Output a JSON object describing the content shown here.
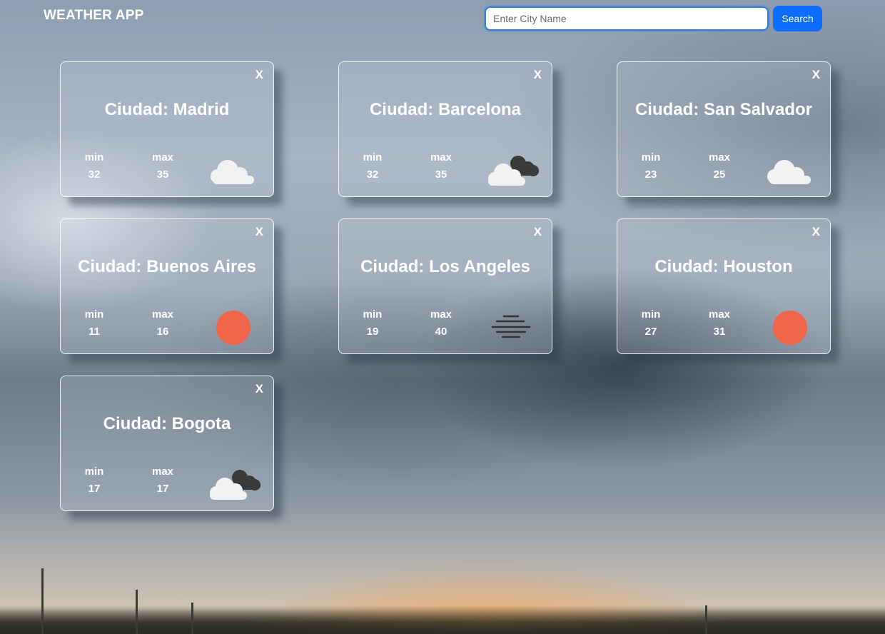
{
  "header": {
    "title": "WEATHER APP",
    "search_placeholder": "Enter City Name",
    "search_value": "",
    "search_label": "Search"
  },
  "colors": {
    "accent": "#0d6efd",
    "sun": "#f0644a",
    "cloud": "#f2f2f2",
    "dark_cloud": "#3a3a3a"
  },
  "cards": [
    {
      "city": "Ciudad: Madrid",
      "min_label": "min",
      "max_label": "max",
      "min": "32",
      "max": "35",
      "icon": "cloud-icon",
      "close": "X"
    },
    {
      "city": "Ciudad: Barcelona",
      "min_label": "min",
      "max_label": "max",
      "min": "32",
      "max": "35",
      "icon": "broken-clouds-icon",
      "close": "X"
    },
    {
      "city": "Ciudad: San Salvador",
      "min_label": "min",
      "max_label": "max",
      "min": "23",
      "max": "25",
      "icon": "cloud-icon",
      "close": "X"
    },
    {
      "city": "Ciudad: Buenos Aires",
      "min_label": "min",
      "max_label": "max",
      "min": "11",
      "max": "16",
      "icon": "sun-icon",
      "close": "X"
    },
    {
      "city": "Ciudad: Los Angeles",
      "min_label": "min",
      "max_label": "max",
      "min": "19",
      "max": "40",
      "icon": "mist-icon",
      "close": "X"
    },
    {
      "city": "Ciudad: Houston",
      "min_label": "min",
      "max_label": "max",
      "min": "27",
      "max": "31",
      "icon": "sun-icon",
      "close": "X"
    },
    {
      "city": "Ciudad: Bogota",
      "min_label": "min",
      "max_label": "max",
      "min": "17",
      "max": "17",
      "icon": "broken-clouds-icon",
      "close": "X"
    }
  ]
}
